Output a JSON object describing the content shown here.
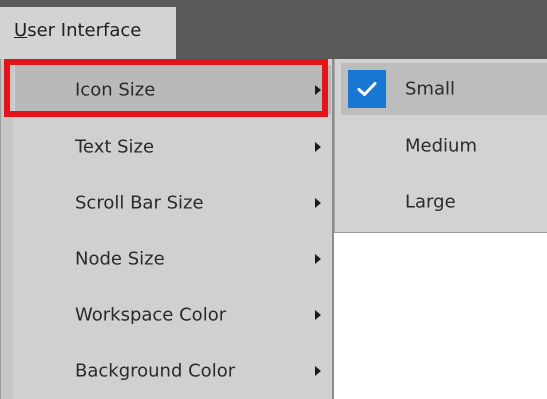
{
  "menubar": {
    "menu_mnemonic": "U",
    "menu_rest": "ser Interface"
  },
  "menu": {
    "items": [
      {
        "label": "Icon Size",
        "has_submenu": true,
        "active": true
      },
      {
        "label": "Text Size",
        "has_submenu": true
      },
      {
        "label": "Scroll Bar Size",
        "has_submenu": true
      },
      {
        "label": "Node Size",
        "has_submenu": true
      },
      {
        "label": "Workspace Color",
        "has_submenu": true
      },
      {
        "label": "Background Color",
        "has_submenu": true
      }
    ]
  },
  "submenu": {
    "items": [
      {
        "label": "Small",
        "checked": true
      },
      {
        "label": "Medium",
        "checked": false
      },
      {
        "label": "Large",
        "checked": false
      }
    ]
  },
  "colors": {
    "highlight_box": "#e4141b",
    "check_accent": "#1977d4",
    "menubar_background": "#5a5a5a",
    "menu_background": "#d0d0d0"
  },
  "icons": {
    "submenu_arrow": "chevron-right-icon",
    "check": "checkmark-icon"
  }
}
